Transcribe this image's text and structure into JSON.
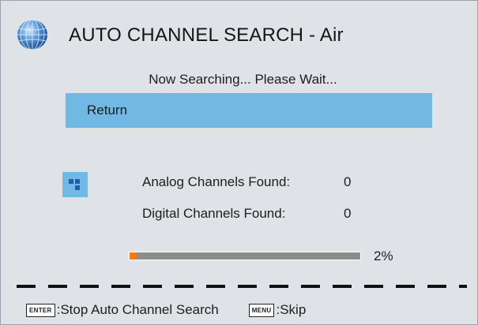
{
  "header": {
    "title": "AUTO CHANNEL SEARCH - Air",
    "icon": "globe-icon"
  },
  "status_text": "Now Searching... Please Wait...",
  "menu": {
    "return_label": "Return"
  },
  "results": {
    "icon": "grid-icon",
    "analog_label": "Analog Channels Found:",
    "analog_value": "0",
    "digital_label": "Digital Channels Found:",
    "digital_value": "0"
  },
  "progress": {
    "fraction": 0.02,
    "label": "2%"
  },
  "footer": {
    "enter_key": "ENTER",
    "enter_action": ":Stop Auto Channel Search",
    "menu_key": "MENU",
    "menu_action": ":Skip"
  },
  "colors": {
    "background": "#dfe3e7",
    "highlight": "#71b8e4",
    "progress_fill": "#f07a1a",
    "progress_track": "#8c8c8c"
  }
}
